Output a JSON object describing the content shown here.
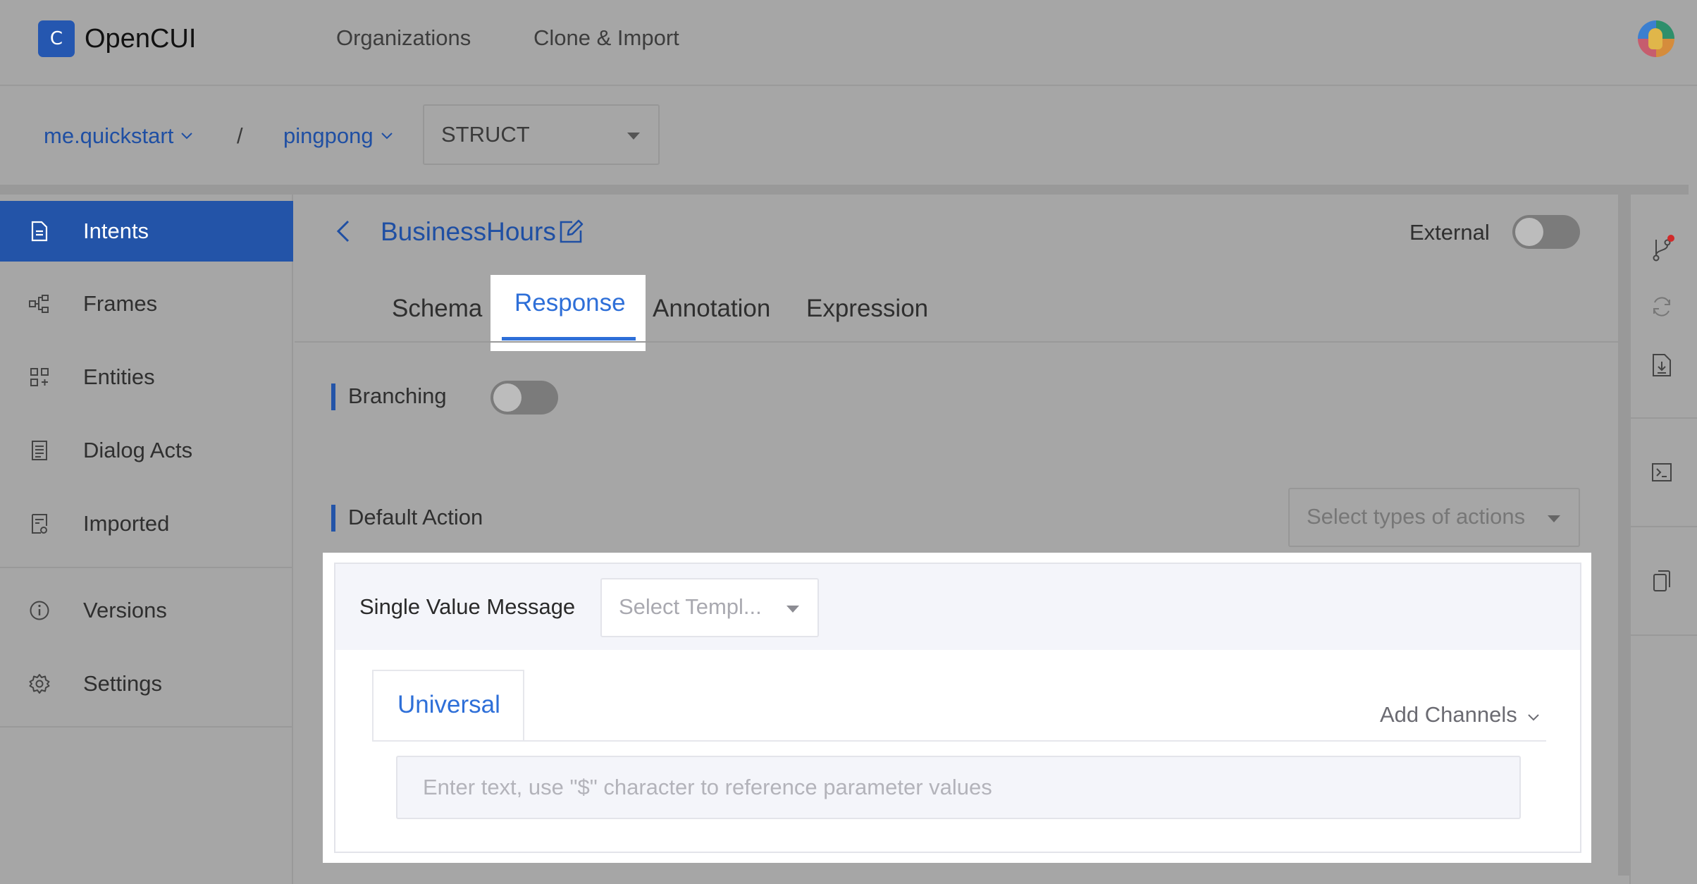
{
  "app": {
    "name": "OpenCUI",
    "logo_glyph": "C",
    "brand_color": "#2557b0",
    "accent_color": "#2e6fd8"
  },
  "topnav": {
    "links": [
      "Organizations",
      "Clone & Import"
    ]
  },
  "breadcrumb": {
    "org": "me.quickstart",
    "separator": "/",
    "project": "pingpong",
    "type_select_value": "STRUCT"
  },
  "sidebar": {
    "items": [
      {
        "label": "Intents",
        "icon": "document-icon",
        "active": true
      },
      {
        "label": "Frames",
        "icon": "frames-icon",
        "active": false
      },
      {
        "label": "Entities",
        "icon": "grid-icon",
        "active": false
      },
      {
        "label": "Dialog Acts",
        "icon": "list-doc-icon",
        "active": false
      },
      {
        "label": "Imported",
        "icon": "import-doc-icon",
        "active": false
      },
      {
        "label": "Versions",
        "icon": "info-icon",
        "active": false
      },
      {
        "label": "Settings",
        "icon": "gear-icon",
        "active": false
      }
    ]
  },
  "header": {
    "title": "BusinessHours",
    "external_label": "External",
    "external_on": false
  },
  "tabs": {
    "items": [
      "Schema",
      "Response",
      "Annotation",
      "Expression"
    ],
    "active": "Response"
  },
  "response": {
    "branching_label": "Branching",
    "branching_on": false,
    "default_action_label": "Default Action",
    "actions_placeholder": "Select types of actions",
    "message_type_label": "Single Value Message",
    "template_placeholder": "Select Templ...",
    "channel_tab": "Universal",
    "add_channels": "Add Channels",
    "input_placeholder": "Enter text, use \"$\" character to reference parameter values",
    "input_value": ""
  },
  "right_rail": {
    "icons": [
      "git-branch-icon",
      "sync-icon",
      "document-export-icon",
      "terminal-icon",
      "copy-icon"
    ]
  }
}
